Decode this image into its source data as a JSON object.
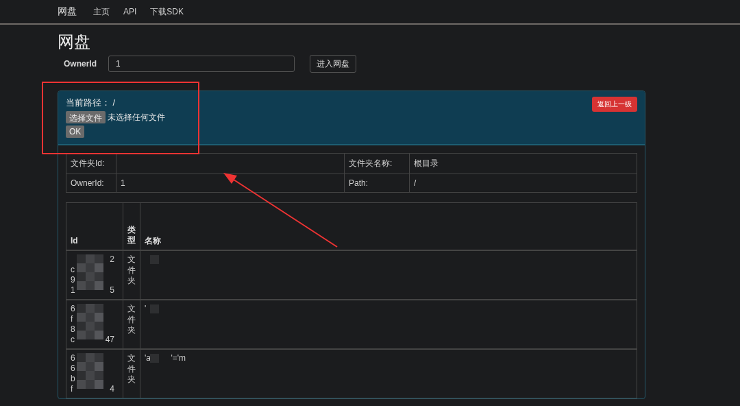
{
  "navbar": {
    "brand": "网盘",
    "links": [
      {
        "label": "主页"
      },
      {
        "label": "API"
      },
      {
        "label": "下载SDK"
      }
    ]
  },
  "title": "网盘",
  "owner_form": {
    "label": "OwnerId",
    "value": "1",
    "button": "进入网盘"
  },
  "panel": {
    "path_label": "当前路径：",
    "path": "/",
    "file_button": "选择文件",
    "file_status": "未选择任何文件",
    "ok_button": "OK",
    "back_button": "返回上一级"
  },
  "folder_info": [
    {
      "label": "文件夹Id:",
      "label_2": "文件夹名称:",
      "value_2": "根目录"
    },
    {
      "label": "OwnerId:",
      "value": "1",
      "label_2": "Path:",
      "value_2": "/"
    }
  ],
  "table": {
    "columns": [
      "Id",
      "类型",
      "名称"
    ],
    "rows": [
      {
        "id_lines": [
          {
            "tail": "2"
          },
          {
            "head": "c"
          },
          {
            "head": "9"
          },
          {
            "head": "1",
            "tail": "5"
          }
        ],
        "type": "文件夹",
        "name": {}
      },
      {
        "id_lines": [
          {
            "head": "6"
          },
          {
            "head": "f"
          },
          {
            "head": "8"
          },
          {
            "head": "c",
            "tail": "47"
          }
        ],
        "type": "文件夹",
        "name": {
          "head": "'"
        }
      },
      {
        "id_lines": [
          {
            "head": "6"
          },
          {
            "head": "6"
          },
          {
            "head": "b"
          },
          {
            "head": "f",
            "tail": "4"
          }
        ],
        "type": "文件夹",
        "name": {
          "head": "'a",
          "tail": "'='m"
        }
      }
    ]
  },
  "annotation": {
    "kind": "highlight"
  }
}
